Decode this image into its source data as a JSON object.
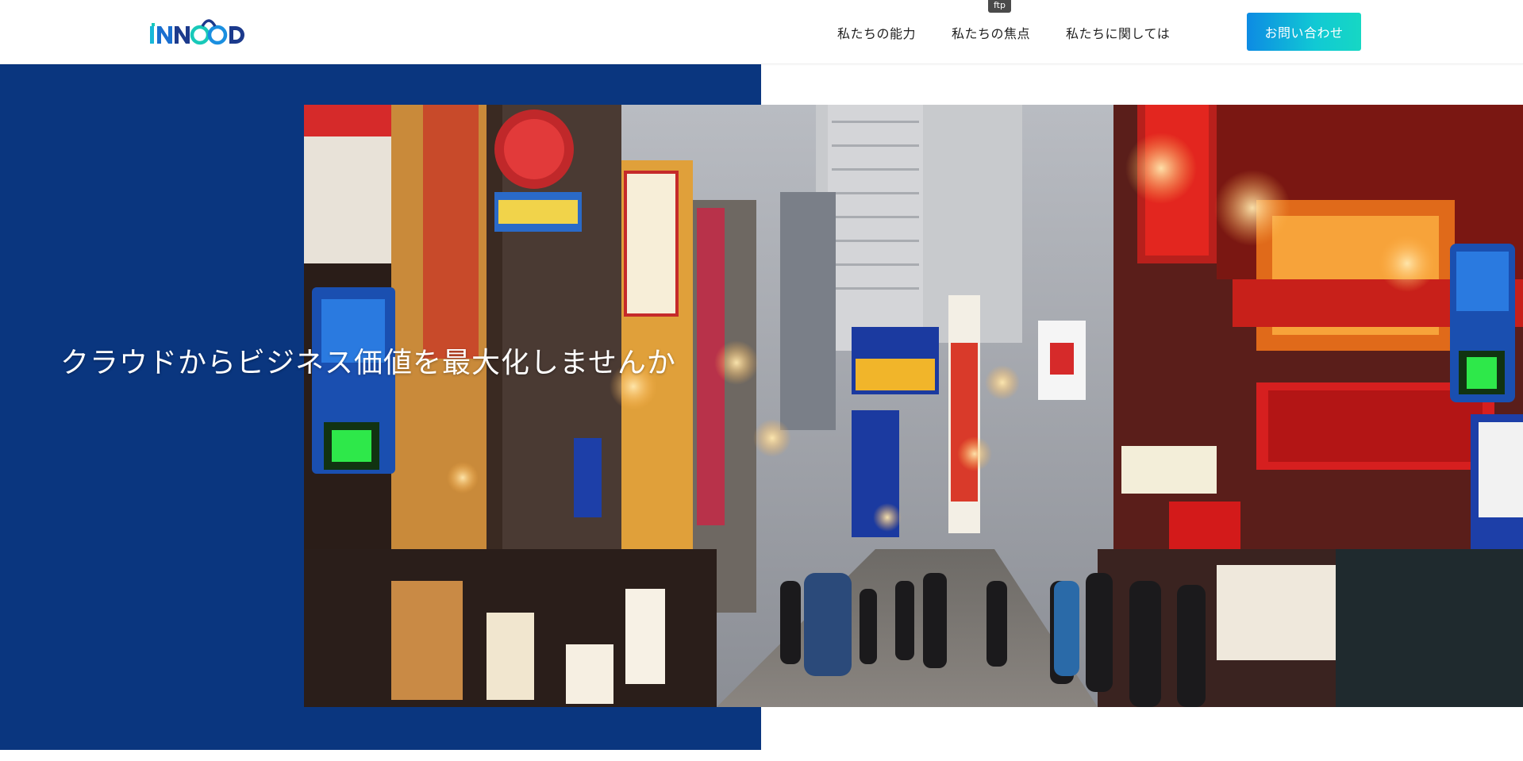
{
  "logo": {
    "text": "NNGOD"
  },
  "nav": {
    "tooltip": "ftp",
    "items": [
      {
        "label": "私たちの能力"
      },
      {
        "label": "私たちの焦点"
      },
      {
        "label": "私たちに関しては"
      }
    ]
  },
  "header": {
    "cta_label": "お問い合わせ"
  },
  "hero": {
    "title": "クラウドからビジネス価値を最大化しませんか",
    "image_description": "night street with neon signs",
    "colors": {
      "panel": "#0a367f",
      "cta_start": "#0d8be3",
      "cta_end": "#16d7c4"
    }
  }
}
